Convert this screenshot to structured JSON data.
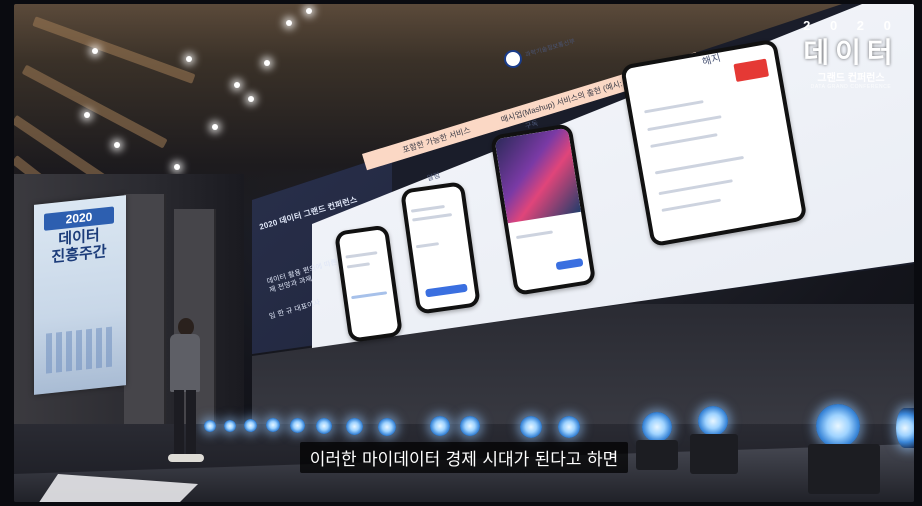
{
  "subtitle": {
    "text": "이러한 마이데이터 경제 시대가 된다고 하면"
  },
  "logo": {
    "year": "2 0 2 0",
    "title": "데이터",
    "subtitle": "그랜드 컨퍼런스",
    "tagline": "DATA GRAND CONFERENCE"
  },
  "banner": {
    "year": "2020",
    "title_line1": "데이터",
    "title_line2": "진흥주간"
  },
  "slide": {
    "header_left": "2020 데이터 그랜드 컨퍼런스",
    "section_heading": "매시업(Mashup) 서비스의 출현 (예시: 왓챠)",
    "section_label": "포함한 가능한 서비스",
    "side_text": "데이터 활용 편의에 따른 데이터 경제 전망과 과제",
    "speaker": "임 한 규 대표이사",
    "org": "과학기술정보통신부",
    "phone_labels": [
      "알림",
      "구독",
      "해지"
    ]
  },
  "colors": {
    "screen_light": "#f2f5fa",
    "accent_blue": "#3a6fe0",
    "accent_red": "#e53935",
    "subtitle_bg": "#000000",
    "light_blue": "#9fd3ff"
  },
  "icons": [
    "government-emblem-icon"
  ]
}
